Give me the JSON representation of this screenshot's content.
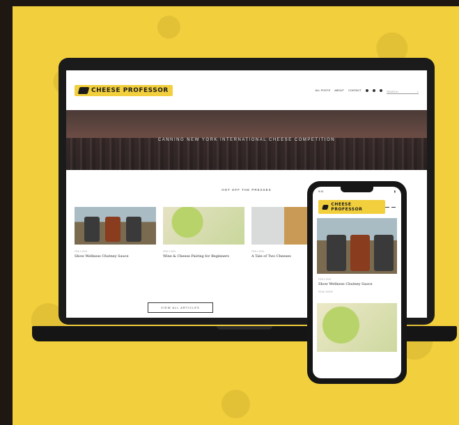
{
  "brand": {
    "name": "CHEESE PROFESSOR",
    "color": "#f2cf3d"
  },
  "nav": {
    "items": [
      "ALL POSTS",
      "ABOUT",
      "CONTACT"
    ],
    "search_placeholder": "SEARCH"
  },
  "hero": {
    "title": "CANNING NEW YORK INTERNATIONAL CHEESE COMPETITION"
  },
  "section": {
    "label": "HOT OFF THE PRESSES"
  },
  "articles": [
    {
      "meta": "FEB 4 2021",
      "title": "Show Wellness Chutney Sauce"
    },
    {
      "meta": "FEB 4 2021",
      "title": "Wine & Cheese Pairing for Beginners"
    },
    {
      "meta": "FEB 4 2021",
      "title": "A Tale of Two Cheeses"
    }
  ],
  "buttons": {
    "view_all": "VIEW ALL ARTICLES"
  },
  "phone": {
    "status_time": "9:41",
    "article": {
      "meta": "FEB 4 2021",
      "title": "Show Wellness Chutney Sauce",
      "more": "READ MORE"
    }
  }
}
